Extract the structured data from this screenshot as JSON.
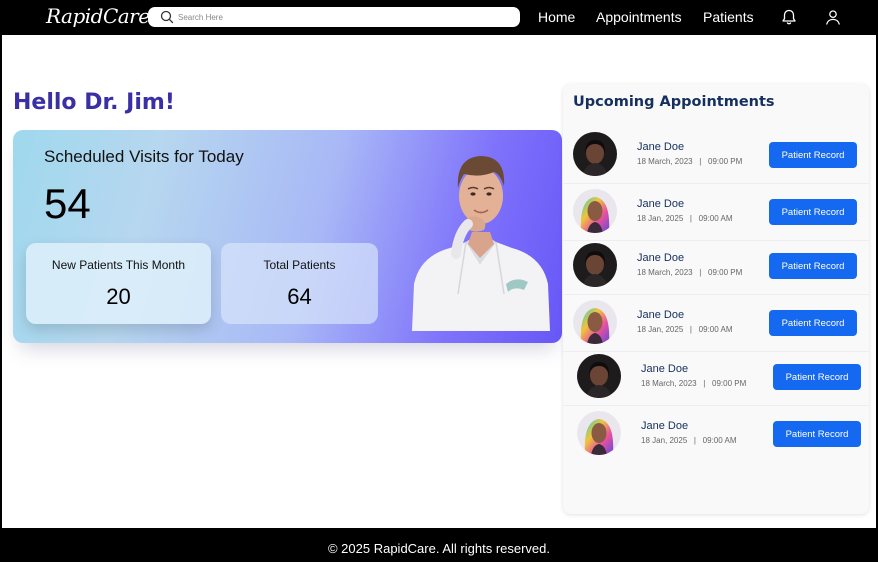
{
  "nav": {
    "logo": "RapidCare",
    "search_placeholder": "Search Here",
    "links": [
      "Home",
      "Appointments",
      "Patients"
    ]
  },
  "greeting": "Hello Dr. Jim!",
  "hero": {
    "title": "Scheduled Visits for Today",
    "count": "54",
    "stats": [
      {
        "label": "New Patients This Month",
        "value": "20"
      },
      {
        "label": "Total Patients",
        "value": "64"
      }
    ]
  },
  "appointments": {
    "title": "Upcoming Appointments",
    "button_label": "Patient Record",
    "items": [
      {
        "name": "Jane Doe",
        "date": "18 March, 2023",
        "time": "09:00 PM",
        "avatar": "dark"
      },
      {
        "name": "Jane Doe",
        "date": "18 Jan, 2025",
        "time": "09:00 AM",
        "avatar": "colorful"
      },
      {
        "name": "Jane Doe",
        "date": "18 March, 2023",
        "time": "09:00 PM",
        "avatar": "dark"
      },
      {
        "name": "Jane Doe",
        "date": "18 Jan, 2025",
        "time": "09:00 AM",
        "avatar": "colorful"
      },
      {
        "name": "Jane Doe",
        "date": "18 March, 2023",
        "time": "09:00 PM",
        "avatar": "dark"
      },
      {
        "name": "Jane Doe",
        "date": "18 Jan, 2025",
        "time": "09:00 AM",
        "avatar": "colorful"
      }
    ]
  },
  "footer": "© 2025 RapidCare. All rights reserved.",
  "colors": {
    "accent": "#1469f0",
    "heading": "#3b2fa6",
    "nav_bg": "#000000"
  },
  "icons": {
    "search": "search-icon",
    "notifications": "bell-icon",
    "profile": "user-icon"
  }
}
